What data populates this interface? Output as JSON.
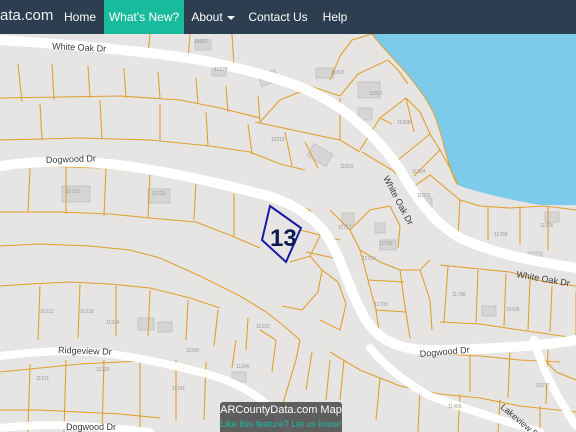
{
  "navbar": {
    "brand_prefix": "...",
    "brand_text": "ata.com",
    "items": [
      {
        "label": "Home"
      },
      {
        "label": "What's New?"
      },
      {
        "label": "About"
      },
      {
        "label": "Contact Us"
      },
      {
        "label": "Help"
      }
    ]
  },
  "map": {
    "roads": {
      "white_oak_dr_north": "White Oak Dr",
      "dogwood_dr_west": "Dogwood Dr",
      "white_oak_dr_diag": "White Oak Dr",
      "white_oak_dr_east": "White Oak Dr",
      "ridgeview_dr": "Ridgeview Dr",
      "dogwood_dr_south": "Dogwood Dr",
      "dogwood_dr_bottom": "Dogwood Dr",
      "lakeview_dr": "Lakeview Dr"
    },
    "parcel_numbers": [
      "11832",
      "11828",
      "11816",
      "11812",
      "11808",
      "11819",
      "11815",
      "11804",
      "11801",
      "11723",
      "11713",
      "11703",
      "11700",
      "11709",
      "11700",
      "11705",
      "11799",
      "11788",
      "11606",
      "11212",
      "11318",
      "11334",
      "11342",
      "11346",
      "11332",
      "11311",
      "11325",
      "11141",
      "11468",
      "11677"
    ],
    "marker_label": "13"
  },
  "colors": {
    "navbar": "#2c3e50",
    "active_tab": "#18bc9c",
    "parcel_line": "#e0a030",
    "water": "#7ccbeb",
    "land": "#e6e5e3",
    "road": "#ffffff",
    "highlight": "#1a1aa8"
  },
  "attribution": {
    "title": "ARCountyData.com Map",
    "link": "Like this feature? Let us know!"
  }
}
